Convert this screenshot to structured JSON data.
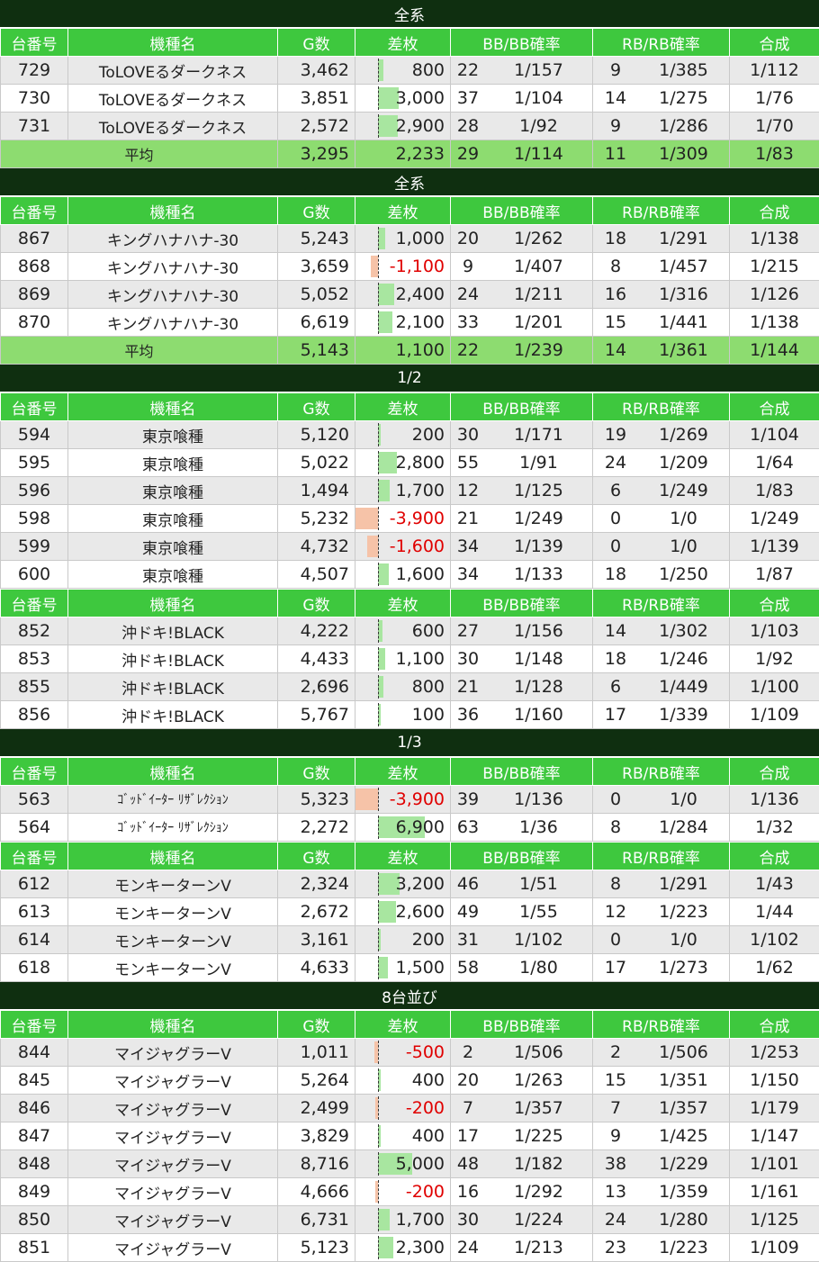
{
  "columns": [
    "台番号",
    "機種名",
    "G数",
    "差枚",
    "BB/BB確率",
    "RB/RB確率",
    "合成"
  ],
  "colors": {
    "header_bg": "#3ec83e",
    "section_bg": "#0f2f10",
    "avg_bg": "#8ddc70",
    "pos_bar": "#a8e6a0",
    "neg_bar": "#f6c3a8",
    "neg_text": "#e00000"
  },
  "sections": [
    {
      "title": "全系",
      "groups": [
        {
          "rows": [
            {
              "no": "729",
              "model": "ToLOVEるダークネス",
              "g": "3,462",
              "diff": "800",
              "dv": 800,
              "bb": "22",
              "bbp": "1/157",
              "rb": "9",
              "rbp": "1/385",
              "comb": "1/112"
            },
            {
              "no": "730",
              "model": "ToLOVEるダークネス",
              "g": "3,851",
              "diff": "3,000",
              "dv": 3000,
              "bb": "37",
              "bbp": "1/104",
              "rb": "14",
              "rbp": "1/275",
              "comb": "1/76"
            },
            {
              "no": "731",
              "model": "ToLOVEるダークネス",
              "g": "2,572",
              "diff": "2,900",
              "dv": 2900,
              "bb": "28",
              "bbp": "1/92",
              "rb": "9",
              "rbp": "1/286",
              "comb": "1/70"
            }
          ],
          "avg": {
            "label": "平均",
            "g": "3,295",
            "diff": "2,233",
            "bb": "29",
            "bbp": "1/114",
            "rb": "11",
            "rbp": "1/309",
            "comb": "1/83"
          }
        }
      ]
    },
    {
      "title": "全系",
      "groups": [
        {
          "rows": [
            {
              "no": "867",
              "model": "キングハナハナ-30",
              "g": "5,243",
              "diff": "1,000",
              "dv": 1000,
              "bb": "20",
              "bbp": "1/262",
              "rb": "18",
              "rbp": "1/291",
              "comb": "1/138"
            },
            {
              "no": "868",
              "model": "キングハナハナ-30",
              "g": "3,659",
              "diff": "-1,100",
              "dv": -1100,
              "bb": "9",
              "bbp": "1/407",
              "rb": "8",
              "rbp": "1/457",
              "comb": "1/215"
            },
            {
              "no": "869",
              "model": "キングハナハナ-30",
              "g": "5,052",
              "diff": "2,400",
              "dv": 2400,
              "bb": "24",
              "bbp": "1/211",
              "rb": "16",
              "rbp": "1/316",
              "comb": "1/126"
            },
            {
              "no": "870",
              "model": "キングハナハナ-30",
              "g": "6,619",
              "diff": "2,100",
              "dv": 2100,
              "bb": "33",
              "bbp": "1/201",
              "rb": "15",
              "rbp": "1/441",
              "comb": "1/138"
            }
          ],
          "avg": {
            "label": "平均",
            "g": "5,143",
            "diff": "1,100",
            "bb": "22",
            "bbp": "1/239",
            "rb": "14",
            "rbp": "1/361",
            "comb": "1/144"
          }
        }
      ]
    },
    {
      "title": "1/2",
      "groups": [
        {
          "rows": [
            {
              "no": "594",
              "model": "東京喰種",
              "g": "5,120",
              "diff": "200",
              "dv": 200,
              "bb": "30",
              "bbp": "1/171",
              "rb": "19",
              "rbp": "1/269",
              "comb": "1/104"
            },
            {
              "no": "595",
              "model": "東京喰種",
              "g": "5,022",
              "diff": "2,800",
              "dv": 2800,
              "bb": "55",
              "bbp": "1/91",
              "rb": "24",
              "rbp": "1/209",
              "comb": "1/64"
            },
            {
              "no": "596",
              "model": "東京喰種",
              "g": "1,494",
              "diff": "1,700",
              "dv": 1700,
              "bb": "12",
              "bbp": "1/125",
              "rb": "6",
              "rbp": "1/249",
              "comb": "1/83"
            },
            {
              "no": "598",
              "model": "東京喰種",
              "g": "5,232",
              "diff": "-3,900",
              "dv": -3900,
              "bb": "21",
              "bbp": "1/249",
              "rb": "0",
              "rbp": "1/0",
              "comb": "1/249"
            },
            {
              "no": "599",
              "model": "東京喰種",
              "g": "4,732",
              "diff": "-1,600",
              "dv": -1600,
              "bb": "34",
              "bbp": "1/139",
              "rb": "0",
              "rbp": "1/0",
              "comb": "1/139"
            },
            {
              "no": "600",
              "model": "東京喰種",
              "g": "4,507",
              "diff": "1,600",
              "dv": 1600,
              "bb": "34",
              "bbp": "1/133",
              "rb": "18",
              "rbp": "1/250",
              "comb": "1/87"
            }
          ]
        },
        {
          "rows": [
            {
              "no": "852",
              "model": "沖ドキ!BLACK",
              "g": "4,222",
              "diff": "600",
              "dv": 600,
              "bb": "27",
              "bbp": "1/156",
              "rb": "14",
              "rbp": "1/302",
              "comb": "1/103"
            },
            {
              "no": "853",
              "model": "沖ドキ!BLACK",
              "g": "4,433",
              "diff": "1,100",
              "dv": 1100,
              "bb": "30",
              "bbp": "1/148",
              "rb": "18",
              "rbp": "1/246",
              "comb": "1/92"
            },
            {
              "no": "855",
              "model": "沖ドキ!BLACK",
              "g": "2,696",
              "diff": "800",
              "dv": 800,
              "bb": "21",
              "bbp": "1/128",
              "rb": "6",
              "rbp": "1/449",
              "comb": "1/100"
            },
            {
              "no": "856",
              "model": "沖ドキ!BLACK",
              "g": "5,767",
              "diff": "100",
              "dv": 100,
              "bb": "36",
              "bbp": "1/160",
              "rb": "17",
              "rbp": "1/339",
              "comb": "1/109"
            }
          ]
        }
      ]
    },
    {
      "title": "1/3",
      "groups": [
        {
          "small": true,
          "rows": [
            {
              "no": "563",
              "model": "ｺﾞｯﾄﾞｲｰﾀｰ ﾘｻﾞﾚｸｼｮﾝ",
              "g": "5,323",
              "diff": "-3,900",
              "dv": -3900,
              "bb": "39",
              "bbp": "1/136",
              "rb": "0",
              "rbp": "1/0",
              "comb": "1/136"
            },
            {
              "no": "564",
              "model": "ｺﾞｯﾄﾞｲｰﾀｰ ﾘｻﾞﾚｸｼｮﾝ",
              "g": "2,272",
              "diff": "6,900",
              "dv": 6900,
              "bb": "63",
              "bbp": "1/36",
              "rb": "8",
              "rbp": "1/284",
              "comb": "1/32"
            }
          ]
        },
        {
          "rows": [
            {
              "no": "612",
              "model": "モンキーターンV",
              "g": "2,324",
              "diff": "3,200",
              "dv": 3200,
              "bb": "46",
              "bbp": "1/51",
              "rb": "8",
              "rbp": "1/291",
              "comb": "1/43"
            },
            {
              "no": "613",
              "model": "モンキーターンV",
              "g": "2,672",
              "diff": "2,600",
              "dv": 2600,
              "bb": "49",
              "bbp": "1/55",
              "rb": "12",
              "rbp": "1/223",
              "comb": "1/44"
            },
            {
              "no": "614",
              "model": "モンキーターンV",
              "g": "3,161",
              "diff": "200",
              "dv": 200,
              "bb": "31",
              "bbp": "1/102",
              "rb": "0",
              "rbp": "1/0",
              "comb": "1/102"
            },
            {
              "no": "618",
              "model": "モンキーターンV",
              "g": "4,633",
              "diff": "1,500",
              "dv": 1500,
              "bb": "58",
              "bbp": "1/80",
              "rb": "17",
              "rbp": "1/273",
              "comb": "1/62"
            }
          ]
        }
      ]
    },
    {
      "title": "8台並び",
      "groups": [
        {
          "rows": [
            {
              "no": "844",
              "model": "マイジャグラーV",
              "g": "1,011",
              "diff": "-500",
              "dv": -500,
              "bb": "2",
              "bbp": "1/506",
              "rb": "2",
              "rbp": "1/506",
              "comb": "1/253"
            },
            {
              "no": "845",
              "model": "マイジャグラーV",
              "g": "5,264",
              "diff": "400",
              "dv": 400,
              "bb": "20",
              "bbp": "1/263",
              "rb": "15",
              "rbp": "1/351",
              "comb": "1/150"
            },
            {
              "no": "846",
              "model": "マイジャグラーV",
              "g": "2,499",
              "diff": "-200",
              "dv": -200,
              "bb": "7",
              "bbp": "1/357",
              "rb": "7",
              "rbp": "1/357",
              "comb": "1/179"
            },
            {
              "no": "847",
              "model": "マイジャグラーV",
              "g": "3,829",
              "diff": "400",
              "dv": 400,
              "bb": "17",
              "bbp": "1/225",
              "rb": "9",
              "rbp": "1/425",
              "comb": "1/147"
            },
            {
              "no": "848",
              "model": "マイジャグラーV",
              "g": "8,716",
              "diff": "5,000",
              "dv": 5000,
              "bb": "48",
              "bbp": "1/182",
              "rb": "38",
              "rbp": "1/229",
              "comb": "1/101"
            },
            {
              "no": "849",
              "model": "マイジャグラーV",
              "g": "4,666",
              "diff": "-200",
              "dv": -200,
              "bb": "16",
              "bbp": "1/292",
              "rb": "13",
              "rbp": "1/359",
              "comb": "1/161"
            },
            {
              "no": "850",
              "model": "マイジャグラーV",
              "g": "6,731",
              "diff": "1,700",
              "dv": 1700,
              "bb": "30",
              "bbp": "1/224",
              "rb": "24",
              "rbp": "1/280",
              "comb": "1/125"
            },
            {
              "no": "851",
              "model": "マイジャグラーV",
              "g": "5,123",
              "diff": "2,300",
              "dv": 2300,
              "bb": "24",
              "bbp": "1/213",
              "rb": "23",
              "rbp": "1/223",
              "comb": "1/109"
            }
          ]
        }
      ]
    }
  ]
}
